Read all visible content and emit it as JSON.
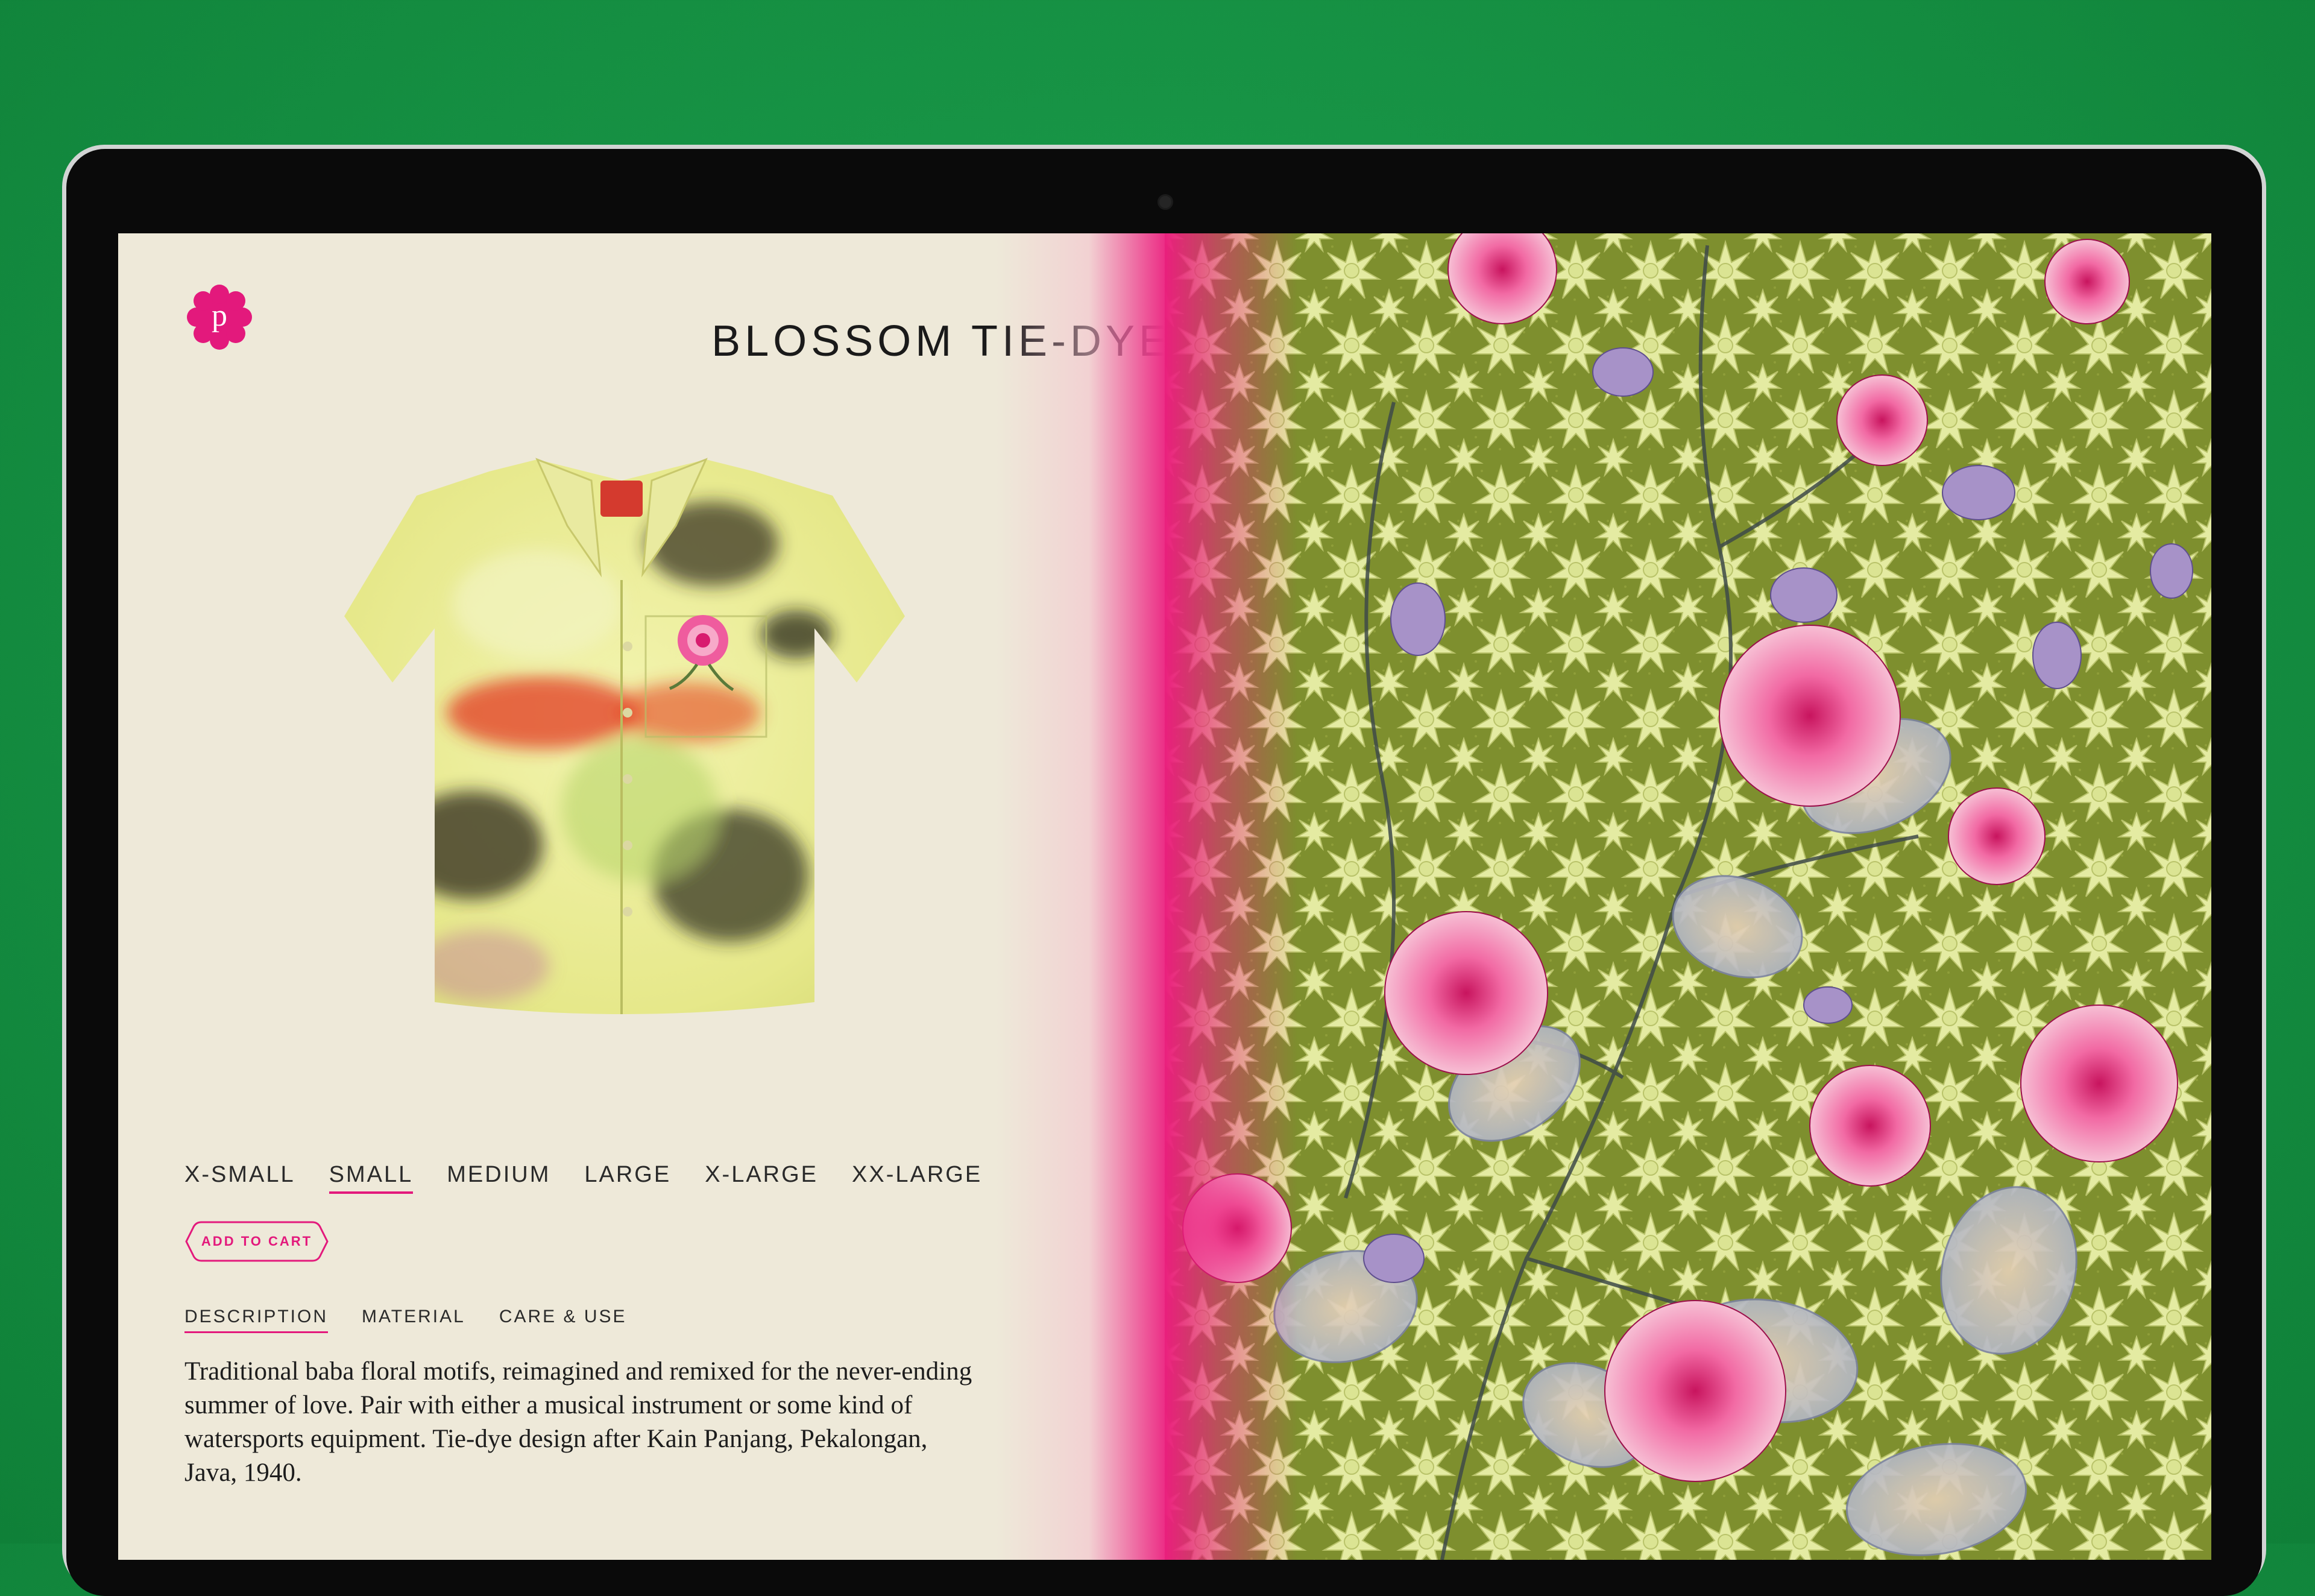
{
  "product": {
    "title": "BLOSSOM TIE-DYE",
    "sizes": [
      "X-SMALL",
      "SMALL",
      "MEDIUM",
      "LARGE",
      "X-LARGE",
      "XX-LARGE"
    ],
    "selected_size": "SMALL",
    "add_to_cart_label": "ADD TO CART",
    "tabs": [
      "DESCRIPTION",
      "MATERIAL",
      "CARE & USE"
    ],
    "active_tab": "DESCRIPTION",
    "description_lines": [
      "Traditional baba floral motifs, reimagined and remixed for the never-ending",
      "summer of love. Pair with either a musical instrument or some kind of",
      "watersports equipment. Tie-dye design after Kain Panjang, Pekalongan,",
      "Java, 1940."
    ]
  },
  "brand": {
    "logo_letter": "p",
    "icon": "flower-logo-icon"
  },
  "colors": {
    "accent": "#e3197c",
    "panel_bg": "#eee9d9",
    "pattern_bg": "#7e8f2e",
    "desktop_bg": "#15903f"
  }
}
